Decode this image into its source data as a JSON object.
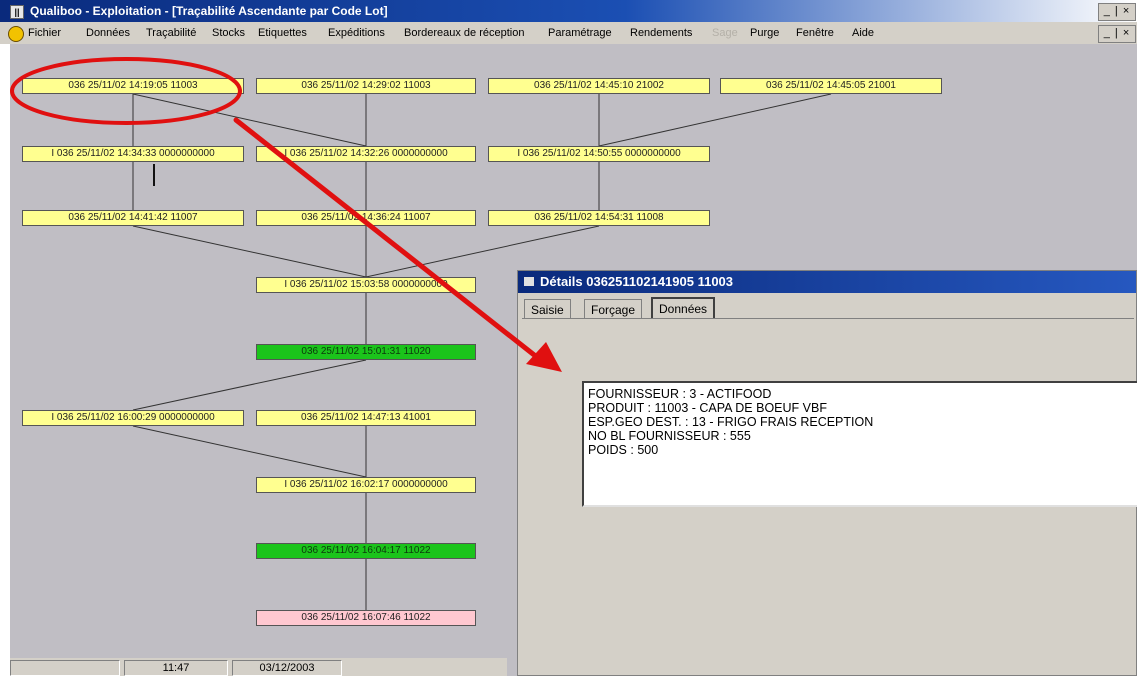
{
  "window": {
    "title": "Qualiboo - Exploitation - [Traçabilité Ascendante par Code Lot]",
    "icon_glyph": "||",
    "controls": "_ | ×",
    "controls_inner": "_ | ×"
  },
  "menu": {
    "logo_icon": "qualiboo-logo-icon",
    "items": [
      {
        "label": "Fichier",
        "enabled": true
      },
      {
        "label": "Données",
        "enabled": true
      },
      {
        "label": "Traçabilité",
        "enabled": true
      },
      {
        "label": "Stocks",
        "enabled": true
      },
      {
        "label": "Etiquettes",
        "enabled": true
      },
      {
        "label": "Expéditions",
        "enabled": true
      },
      {
        "label": "Bordereaux de réception",
        "enabled": true
      },
      {
        "label": "Paramétrage",
        "enabled": true
      },
      {
        "label": "Rendements",
        "enabled": true
      },
      {
        "label": "Sage",
        "enabled": false
      },
      {
        "label": "Purge",
        "enabled": true
      },
      {
        "label": "Fenêtre",
        "enabled": true
      },
      {
        "label": "Aide",
        "enabled": true
      }
    ]
  },
  "tree": {
    "nodes": [
      {
        "id": "n1",
        "label": "036 25/11/02 14:19:05 11003",
        "color": "yellow"
      },
      {
        "id": "n2",
        "label": "036 25/11/02 14:29:02 11003",
        "color": "yellow"
      },
      {
        "id": "n3",
        "label": "036 25/11/02 14:45:10 21002",
        "color": "yellow"
      },
      {
        "id": "n4",
        "label": "036 25/11/02 14:45:05 21001",
        "color": "yellow"
      },
      {
        "id": "n5",
        "label": "I 036 25/11/02 14:34:33 0000000000",
        "color": "yellow"
      },
      {
        "id": "n6",
        "label": "I 036 25/11/02 14:32:26 0000000000",
        "color": "yellow"
      },
      {
        "id": "n7",
        "label": "I 036 25/11/02 14:50:55 0000000000",
        "color": "yellow"
      },
      {
        "id": "n8",
        "label": "036 25/11/02 14:41:42 11007",
        "color": "yellow"
      },
      {
        "id": "n9",
        "label": "036 25/11/02 14:36:24 11007",
        "color": "yellow"
      },
      {
        "id": "n10",
        "label": "036 25/11/02 14:54:31 11008",
        "color": "yellow"
      },
      {
        "id": "n11",
        "label": "I 036 25/11/02 15:03:58 0000000000",
        "color": "yellow"
      },
      {
        "id": "n12",
        "label": "036 25/11/02 15:01:31 11020",
        "color": "green"
      },
      {
        "id": "n13",
        "label": "I 036 25/11/02 16:00:29 0000000000",
        "color": "yellow"
      },
      {
        "id": "n14",
        "label": "036 25/11/02 14:47:13 41001",
        "color": "yellow"
      },
      {
        "id": "n15",
        "label": "I 036 25/11/02 16:02:17 0000000000",
        "color": "yellow"
      },
      {
        "id": "n16",
        "label": "036 25/11/02 16:04:17 11022",
        "color": "green"
      },
      {
        "id": "n17",
        "label": "036 25/11/02 16:07:46 11022",
        "color": "pink"
      }
    ],
    "edges": [
      [
        "n1",
        "n5"
      ],
      [
        "n1",
        "n6"
      ],
      [
        "n2",
        "n6"
      ],
      [
        "n3",
        "n7"
      ],
      [
        "n4",
        "n7"
      ],
      [
        "n5",
        "n8"
      ],
      [
        "n6",
        "n9"
      ],
      [
        "n7",
        "n10"
      ],
      [
        "n8",
        "n11"
      ],
      [
        "n9",
        "n11"
      ],
      [
        "n10",
        "n11"
      ],
      [
        "n11",
        "n12"
      ],
      [
        "n12",
        "n13"
      ],
      [
        "n14",
        "n15"
      ],
      [
        "n13",
        "n15"
      ],
      [
        "n15",
        "n16"
      ],
      [
        "n16",
        "n17"
      ]
    ]
  },
  "status": {
    "time": "11:47",
    "date": "03/12/2003"
  },
  "dialog": {
    "title": "Détails 036251102141905 11003",
    "tabs": [
      {
        "label": "Saisie",
        "active": false
      },
      {
        "label": "Forçage",
        "active": false
      },
      {
        "label": "Données",
        "active": true
      }
    ],
    "details_lines": [
      "FOURNISSEUR : 3 - ACTIFOOD",
      "PRODUIT : 11003 - CAPA DE BOEUF VBF",
      "ESP.GEO DEST. : 13 - FRIGO FRAIS RECEPTION",
      "NO BL FOURNISSEUR : 555",
      "POIDS : 500"
    ]
  },
  "annotation": {
    "color": "#e01010"
  },
  "colors": {
    "node_yellow": "#ffff90",
    "node_green": "#1bc41b",
    "node_pink": "#ffc8d0",
    "titlebar": "#0a2a7c",
    "canvas": "#c0bec4"
  }
}
